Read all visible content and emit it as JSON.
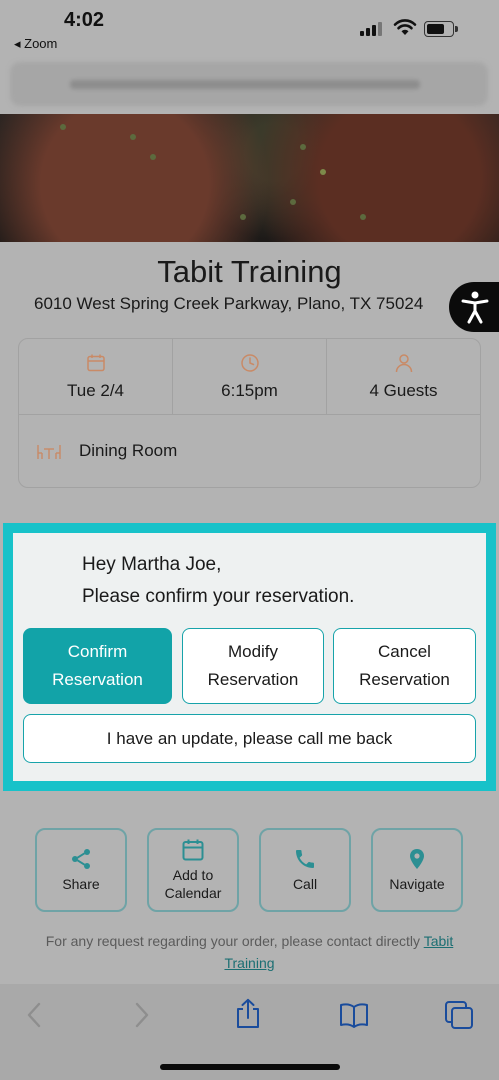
{
  "status_bar": {
    "time": "4:02",
    "back_label": "◂ Zoom"
  },
  "restaurant": {
    "name": "Tabit Training",
    "address": "6010 West Spring Creek Parkway, Plano, TX 75024"
  },
  "reservation": {
    "date": "Tue 2/4",
    "time": "6:15pm",
    "guests": "4 Guests",
    "area": "Dining Room"
  },
  "confirm_panel": {
    "greeting_line1": "Hey Martha Joe,",
    "greeting_line2": "Please confirm your reservation.",
    "confirm_line1": "Confirm",
    "confirm_line2": "Reservation",
    "modify_line1": "Modify",
    "modify_line2": "Reservation",
    "cancel_line1": "Cancel",
    "cancel_line2": "Reservation",
    "callback_label": "I have an update, please call me back"
  },
  "actions": {
    "share": "Share",
    "calendar_line1": "Add to",
    "calendar_line2": "Calendar",
    "call": "Call",
    "navigate": "Navigate"
  },
  "footer": {
    "contact_text": "For any request regarding your order, please contact directly ",
    "contact_link_part1": "Tabit",
    "contact_link_part2": "Training"
  },
  "colors": {
    "accent": "#17c2c9",
    "primary_button": "#12a3a8",
    "icon_tint": "#c98a66",
    "action_teal": "#2c8f93",
    "link": "#1c6f73"
  },
  "icons": [
    "calendar-icon",
    "clock-icon",
    "person-icon",
    "table-icon",
    "accessibility-icon",
    "share-icon",
    "calendar-add-icon",
    "phone-icon",
    "location-pin-icon",
    "back-arrow-icon",
    "forward-arrow-icon",
    "share-upload-icon",
    "bookmarks-icon",
    "tabs-icon"
  ]
}
